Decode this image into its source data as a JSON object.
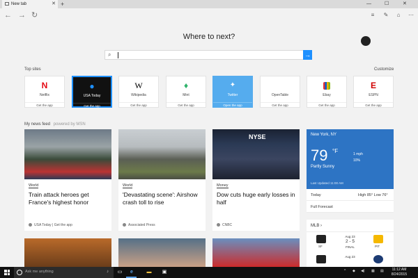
{
  "browser": {
    "tab_title": "New tab",
    "new_tab_symbol": "+",
    "close_symbol": "✕"
  },
  "heading": "Where to next?",
  "search": {
    "value": "",
    "placeholder": ""
  },
  "top_sites_label": "Top sites",
  "customize_label": "Customize",
  "top_sites": [
    {
      "name": "Netflix",
      "app": "Get the app",
      "logo": "N",
      "logo_color": "#e50914"
    },
    {
      "name": "USA Today",
      "app": "Get the app",
      "logo": "●",
      "logo_color": "#1e90ff"
    },
    {
      "name": "Wikipedia",
      "app": "Get the app",
      "logo": "W",
      "logo_color": "#222222"
    },
    {
      "name": "Mint",
      "app": "Get the app",
      "logo": "♦",
      "logo_color": "#2fb36b"
    },
    {
      "name": "Twitter",
      "app": "Open the app",
      "logo": "🐦",
      "logo_color": "#ffffff"
    },
    {
      "name": "OpenTable",
      "app": "Get the app",
      "logo": "",
      "logo_color": "#da3743"
    },
    {
      "name": "Ebay",
      "app": "Get the app",
      "logo": "🛍",
      "logo_color": "#e53238"
    },
    {
      "name": "ESPN",
      "app": "Get the app",
      "logo": "E",
      "logo_color": "#d00000"
    }
  ],
  "news_feed_label": "My news feed",
  "powered_by": "powered by MSN",
  "news": [
    {
      "category": "World",
      "title": "Train attack heroes get France's highest honor",
      "source": "USA Today | Get the app"
    },
    {
      "category": "World",
      "title": "'Devastating scene': Airshow crash toll to rise",
      "source": "Associated Press"
    },
    {
      "category": "Money",
      "title": "Dow cuts huge early losses in half",
      "source": "CNBC"
    }
  ],
  "weather": {
    "location": "New York, NY",
    "temp": "79",
    "unit": "°F",
    "wind": "1 mph",
    "humidity": "10%",
    "condition": "Partly Sunny",
    "updated": "Last Updated 11:00 AM",
    "today_label": "Today",
    "today_value": "High 85° Low 76°",
    "forecast_label": "Full Forecast"
  },
  "mlb": {
    "label": "MLB",
    "games": [
      {
        "date": "Aug 23",
        "score": "2 - 5",
        "status": "FINAL",
        "away": "SF",
        "home": "PIT"
      },
      {
        "date": "Aug 23",
        "score": "",
        "status": "",
        "away": "",
        "home": ""
      }
    ]
  },
  "taskbar": {
    "search_placeholder": "Ask me anything",
    "time": "11:12 AM",
    "date": "8/24/2015"
  }
}
